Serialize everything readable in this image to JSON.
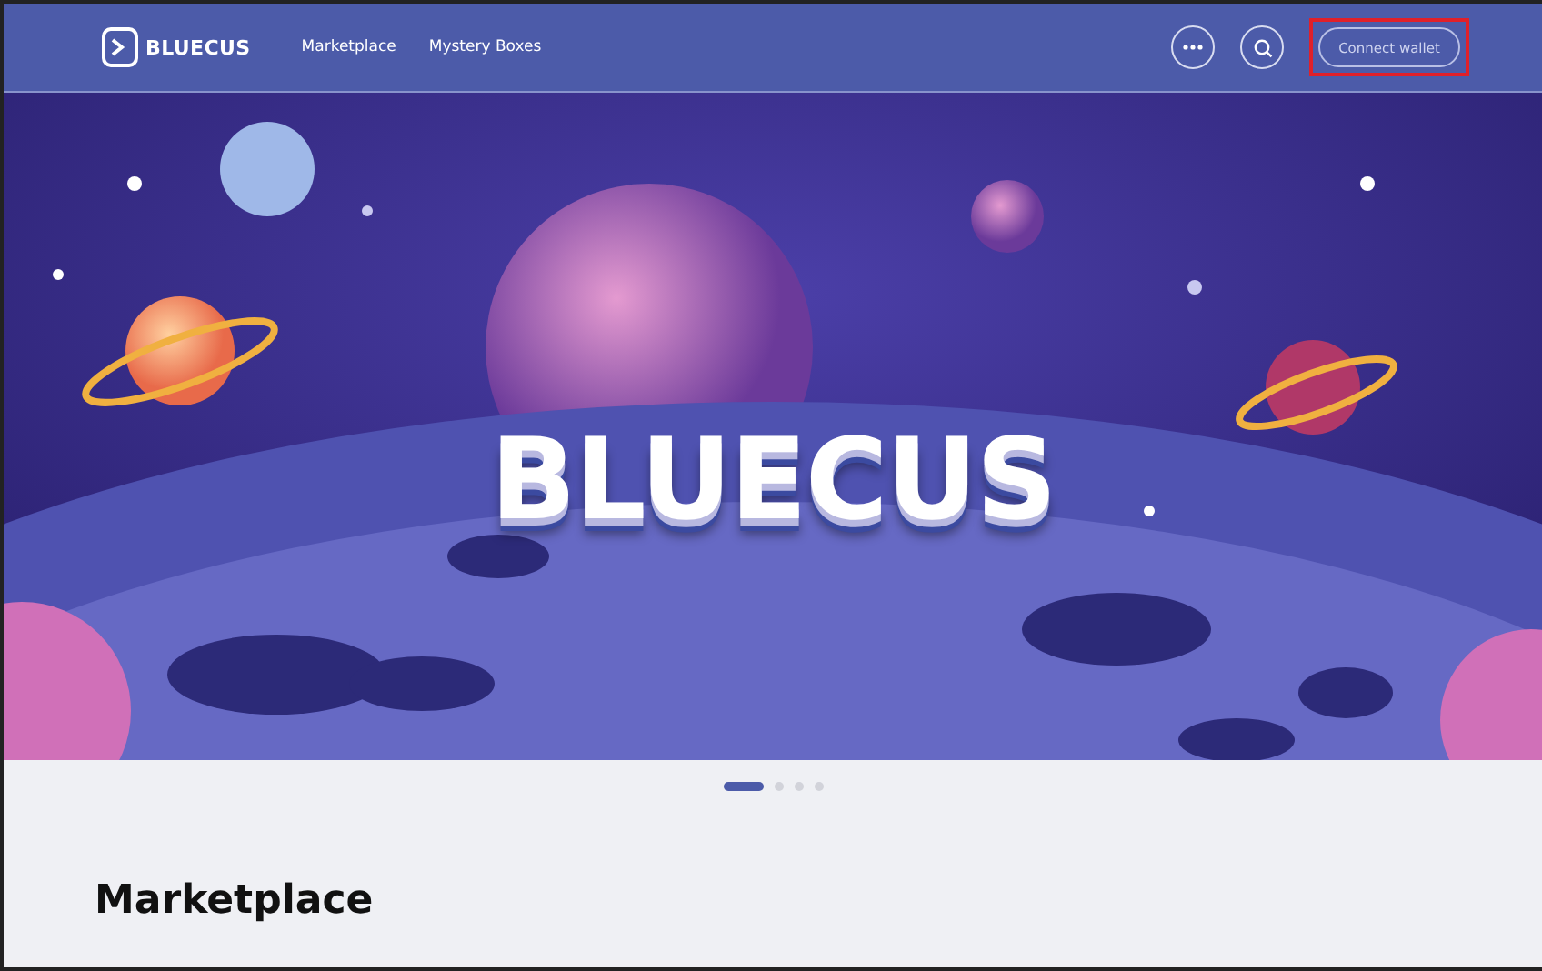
{
  "header": {
    "logo": "BLUECUS",
    "nav": [
      {
        "label": "Marketplace"
      },
      {
        "label": "Mystery Boxes"
      }
    ],
    "connect_button": {
      "label": "Connect wallet",
      "highlighted": true
    }
  },
  "banner": {
    "title": "BLUECUS"
  },
  "carousel": {
    "slides": [
      {
        "selected": true
      },
      {
        "selected": false
      },
      {
        "selected": false
      },
      {
        "selected": false
      }
    ]
  },
  "section": {
    "heading": "Marketplace"
  }
}
